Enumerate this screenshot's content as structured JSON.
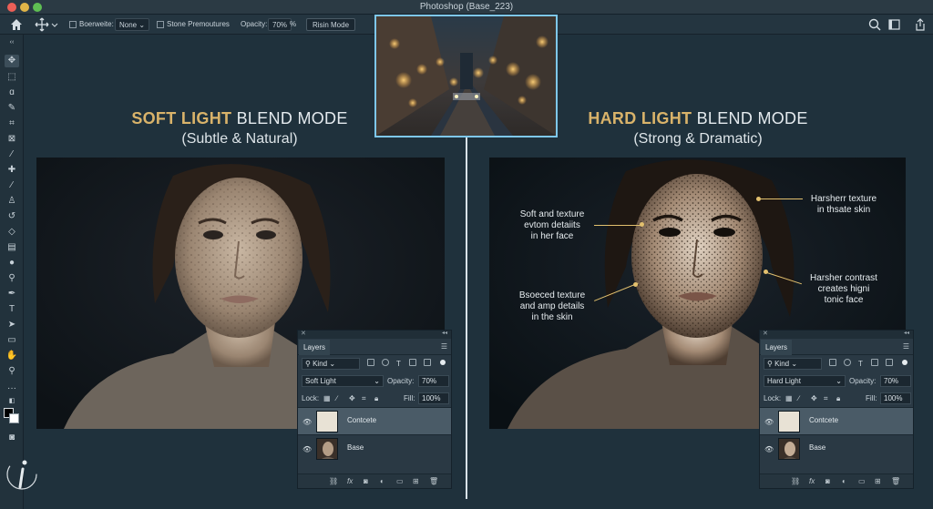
{
  "app": {
    "title": "Photoshop (Base_223)"
  },
  "options_bar": {
    "border_width_label": "Boerweite:",
    "border_width_value": "None",
    "stone_label": "Stone Premoutures",
    "opacity_label": "Opacity:",
    "opacity_value": "70%",
    "opacity_unit": "%",
    "mode_button": "Risin Mode"
  },
  "left": {
    "heading_accent": "SOFT LIGHT",
    "heading_rest": " BLEND MODE",
    "subheading": "(Subtle & Natural)"
  },
  "right": {
    "heading_accent": "HARD LIGHT",
    "heading_rest": " BLEND MODE",
    "subheading": "(Strong & Dramatic)",
    "annotations": [
      {
        "lines": [
          "Soft and texture",
          "evtom detaiits",
          "in her face"
        ]
      },
      {
        "lines": [
          "Bsoeced texture",
          "and amp details",
          "in the skin"
        ]
      },
      {
        "lines": [
          "Harsherr texture",
          "in thsate skin"
        ]
      },
      {
        "lines": [
          "Harsher contrast",
          "creates higni",
          "tonic face"
        ]
      }
    ]
  },
  "layers_panels": [
    {
      "tab": "Layers",
      "filter": "Kind",
      "blend_mode": "Soft Light",
      "opacity_label": "Opacity:",
      "opacity_value": "70%",
      "lock_label": "Lock:",
      "fill_label": "Fill:",
      "fill_value": "100%",
      "layers": [
        {
          "name": "Contcete",
          "selected": true
        },
        {
          "name": "Base",
          "selected": false
        }
      ]
    },
    {
      "tab": "Layers",
      "filter": "Kind",
      "blend_mode": "Hard Light",
      "opacity_label": "Opacity:",
      "opacity_value": "70%",
      "lock_label": "Lock:",
      "fill_label": "Fill:",
      "fill_value": "100%",
      "layers": [
        {
          "name": "Contcete",
          "selected": true
        },
        {
          "name": "Base",
          "selected": false
        }
      ]
    }
  ],
  "colors": {
    "accent_gold": "#d9b36a",
    "selection_blue": "#7ec7ea",
    "annotation_gold": "#e2c06e"
  }
}
